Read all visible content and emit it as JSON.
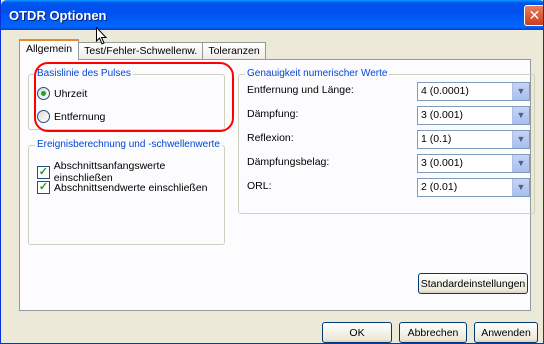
{
  "window": {
    "title": "OTDR Optionen",
    "close_glyph": "✕"
  },
  "tabs": [
    {
      "label": "Allgemein",
      "active": true
    },
    {
      "label": "Test/Fehler-Schwellenw.",
      "active": false
    },
    {
      "label": "Toleranzen",
      "active": false
    }
  ],
  "baseline_group": {
    "title": "Basislinie des Pulses",
    "options": [
      {
        "label": "Uhrzeit",
        "selected": true
      },
      {
        "label": "Entfernung",
        "selected": false
      }
    ]
  },
  "event_group": {
    "title": "Ereignisberechnung und -schwellenwerte",
    "checks": [
      {
        "label": "Abschnittsanfangswerte einschließen",
        "checked": true
      },
      {
        "label": "Abschnittsendwerte einschließen",
        "checked": true
      }
    ]
  },
  "accuracy_group": {
    "title": "Genauigkeit numerischer Werte",
    "fields": [
      {
        "label": "Entfernung und Länge:",
        "value": "4 (0.0001)"
      },
      {
        "label": "Dämpfung:",
        "value": "3 (0.001)"
      },
      {
        "label": "Reflexion:",
        "value": "1 (0.1)"
      },
      {
        "label": "Dämpfungsbelag:",
        "value": "3 (0.001)"
      },
      {
        "label": "ORL:",
        "value": "2 (0.01)"
      }
    ]
  },
  "buttons": {
    "defaults": "Standardeinstellungen",
    "ok": "OK",
    "cancel": "Abbrechen",
    "apply": "Anwenden"
  },
  "colors": {
    "group_title": "#0046d5",
    "highlight": "#ff0000",
    "titlebar": "#0054e3"
  }
}
